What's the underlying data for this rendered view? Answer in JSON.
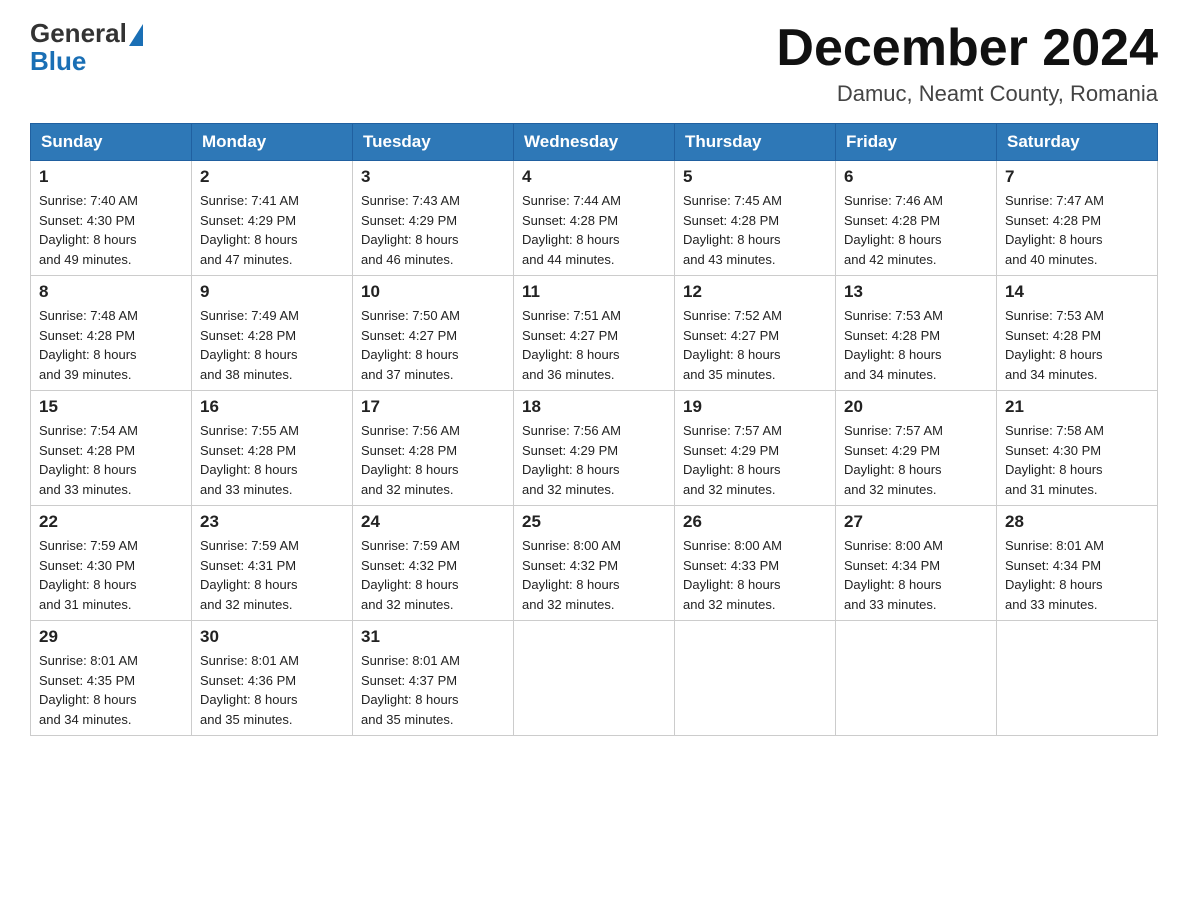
{
  "header": {
    "logo_general": "General",
    "logo_blue": "Blue",
    "month_title": "December 2024",
    "location": "Damuc, Neamt County, Romania"
  },
  "weekdays": [
    "Sunday",
    "Monday",
    "Tuesday",
    "Wednesday",
    "Thursday",
    "Friday",
    "Saturday"
  ],
  "weeks": [
    [
      {
        "day": "1",
        "sunrise": "7:40 AM",
        "sunset": "4:30 PM",
        "daylight": "8 hours and 49 minutes."
      },
      {
        "day": "2",
        "sunrise": "7:41 AM",
        "sunset": "4:29 PM",
        "daylight": "8 hours and 47 minutes."
      },
      {
        "day": "3",
        "sunrise": "7:43 AM",
        "sunset": "4:29 PM",
        "daylight": "8 hours and 46 minutes."
      },
      {
        "day": "4",
        "sunrise": "7:44 AM",
        "sunset": "4:28 PM",
        "daylight": "8 hours and 44 minutes."
      },
      {
        "day": "5",
        "sunrise": "7:45 AM",
        "sunset": "4:28 PM",
        "daylight": "8 hours and 43 minutes."
      },
      {
        "day": "6",
        "sunrise": "7:46 AM",
        "sunset": "4:28 PM",
        "daylight": "8 hours and 42 minutes."
      },
      {
        "day": "7",
        "sunrise": "7:47 AM",
        "sunset": "4:28 PM",
        "daylight": "8 hours and 40 minutes."
      }
    ],
    [
      {
        "day": "8",
        "sunrise": "7:48 AM",
        "sunset": "4:28 PM",
        "daylight": "8 hours and 39 minutes."
      },
      {
        "day": "9",
        "sunrise": "7:49 AM",
        "sunset": "4:28 PM",
        "daylight": "8 hours and 38 minutes."
      },
      {
        "day": "10",
        "sunrise": "7:50 AM",
        "sunset": "4:27 PM",
        "daylight": "8 hours and 37 minutes."
      },
      {
        "day": "11",
        "sunrise": "7:51 AM",
        "sunset": "4:27 PM",
        "daylight": "8 hours and 36 minutes."
      },
      {
        "day": "12",
        "sunrise": "7:52 AM",
        "sunset": "4:27 PM",
        "daylight": "8 hours and 35 minutes."
      },
      {
        "day": "13",
        "sunrise": "7:53 AM",
        "sunset": "4:28 PM",
        "daylight": "8 hours and 34 minutes."
      },
      {
        "day": "14",
        "sunrise": "7:53 AM",
        "sunset": "4:28 PM",
        "daylight": "8 hours and 34 minutes."
      }
    ],
    [
      {
        "day": "15",
        "sunrise": "7:54 AM",
        "sunset": "4:28 PM",
        "daylight": "8 hours and 33 minutes."
      },
      {
        "day": "16",
        "sunrise": "7:55 AM",
        "sunset": "4:28 PM",
        "daylight": "8 hours and 33 minutes."
      },
      {
        "day": "17",
        "sunrise": "7:56 AM",
        "sunset": "4:28 PM",
        "daylight": "8 hours and 32 minutes."
      },
      {
        "day": "18",
        "sunrise": "7:56 AM",
        "sunset": "4:29 PM",
        "daylight": "8 hours and 32 minutes."
      },
      {
        "day": "19",
        "sunrise": "7:57 AM",
        "sunset": "4:29 PM",
        "daylight": "8 hours and 32 minutes."
      },
      {
        "day": "20",
        "sunrise": "7:57 AM",
        "sunset": "4:29 PM",
        "daylight": "8 hours and 32 minutes."
      },
      {
        "day": "21",
        "sunrise": "7:58 AM",
        "sunset": "4:30 PM",
        "daylight": "8 hours and 31 minutes."
      }
    ],
    [
      {
        "day": "22",
        "sunrise": "7:59 AM",
        "sunset": "4:30 PM",
        "daylight": "8 hours and 31 minutes."
      },
      {
        "day": "23",
        "sunrise": "7:59 AM",
        "sunset": "4:31 PM",
        "daylight": "8 hours and 32 minutes."
      },
      {
        "day": "24",
        "sunrise": "7:59 AM",
        "sunset": "4:32 PM",
        "daylight": "8 hours and 32 minutes."
      },
      {
        "day": "25",
        "sunrise": "8:00 AM",
        "sunset": "4:32 PM",
        "daylight": "8 hours and 32 minutes."
      },
      {
        "day": "26",
        "sunrise": "8:00 AM",
        "sunset": "4:33 PM",
        "daylight": "8 hours and 32 minutes."
      },
      {
        "day": "27",
        "sunrise": "8:00 AM",
        "sunset": "4:34 PM",
        "daylight": "8 hours and 33 minutes."
      },
      {
        "day": "28",
        "sunrise": "8:01 AM",
        "sunset": "4:34 PM",
        "daylight": "8 hours and 33 minutes."
      }
    ],
    [
      {
        "day": "29",
        "sunrise": "8:01 AM",
        "sunset": "4:35 PM",
        "daylight": "8 hours and 34 minutes."
      },
      {
        "day": "30",
        "sunrise": "8:01 AM",
        "sunset": "4:36 PM",
        "daylight": "8 hours and 35 minutes."
      },
      {
        "day": "31",
        "sunrise": "8:01 AM",
        "sunset": "4:37 PM",
        "daylight": "8 hours and 35 minutes."
      },
      null,
      null,
      null,
      null
    ]
  ],
  "labels": {
    "sunrise": "Sunrise: ",
    "sunset": "Sunset: ",
    "daylight": "Daylight: "
  }
}
